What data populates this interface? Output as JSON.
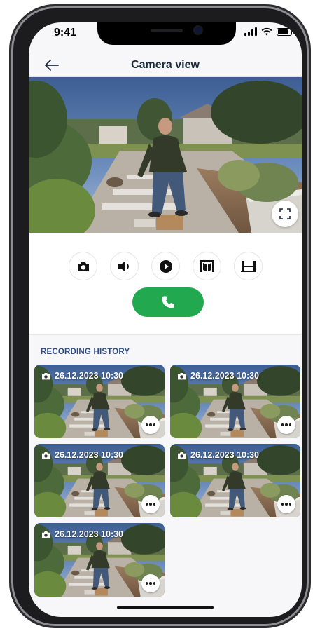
{
  "status_bar": {
    "time": "9:41"
  },
  "header": {
    "title": "Camera view",
    "back_icon": "arrow-left-icon"
  },
  "live_view": {
    "fullscreen_icon": "fullscreen-icon"
  },
  "controls": {
    "buttons": [
      {
        "name": "snapshot",
        "icon": "camera-icon"
      },
      {
        "name": "speaker",
        "icon": "speaker-icon"
      },
      {
        "name": "play",
        "icon": "play-icon"
      },
      {
        "name": "gate-open",
        "icon": "gate-open-icon"
      },
      {
        "name": "gate-close",
        "icon": "gate-close-icon"
      }
    ],
    "call": {
      "icon": "phone-icon",
      "color": "#22a84e"
    }
  },
  "history": {
    "title": "RECORDING HISTORY",
    "recordings": [
      {
        "timestamp": "26.12.2023 10:30"
      },
      {
        "timestamp": "26.12.2023 10:30"
      },
      {
        "timestamp": "26.12.2023 10:30"
      },
      {
        "timestamp": "26.12.2023 10:30"
      },
      {
        "timestamp": "26.12.2023 10:30"
      }
    ]
  },
  "colors": {
    "accent": "#2b4a87",
    "call_green": "#22a84e",
    "background": "#f7f7fa"
  }
}
